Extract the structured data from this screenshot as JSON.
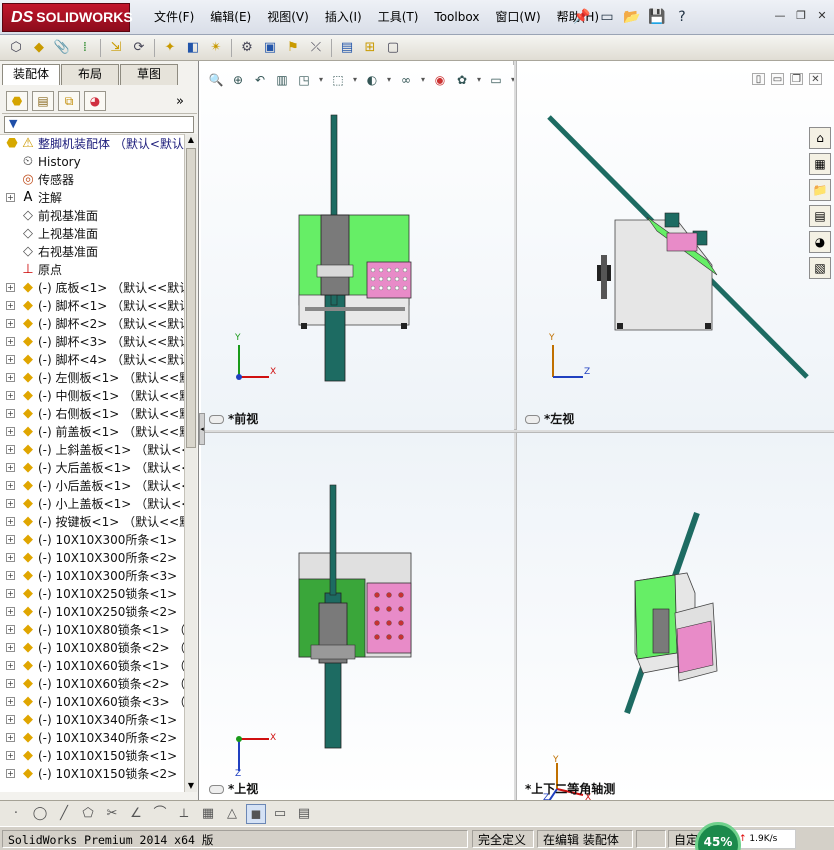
{
  "app": {
    "brand": "SOLIDWORKS",
    "brand_prefix": "DS",
    "menu": [
      "文件(F)",
      "编辑(E)",
      "视图(V)",
      "插入(I)",
      "工具(T)",
      "Toolbox",
      "窗口(W)",
      "帮助(H)"
    ]
  },
  "left_panel": {
    "tabs": [
      "装配体",
      "布局",
      "草图"
    ],
    "active_tab": "装配体",
    "tree": {
      "root": "整脚机装配体 （默认<默认",
      "features": [
        {
          "label": "History",
          "icon": "history-icon"
        },
        {
          "label": "传感器",
          "icon": "sensor-icon"
        },
        {
          "label": "注解",
          "icon": "annotation-icon"
        },
        {
          "label": "前视基准面",
          "icon": "plane-icon"
        },
        {
          "label": "上视基准面",
          "icon": "plane-icon"
        },
        {
          "label": "右视基准面",
          "icon": "plane-icon"
        },
        {
          "label": "原点",
          "icon": "origin-icon"
        }
      ],
      "components": [
        "(-) 底板<1> （默认<<默认",
        "(-) 脚杯<1> （默认<<默认",
        "(-) 脚杯<2> （默认<<默认",
        "(-) 脚杯<3> （默认<<默认",
        "(-) 脚杯<4> （默认<<默认",
        "(-) 左侧板<1> （默认<<默",
        "(-) 中侧板<1> （默认<<默",
        "(-) 右侧板<1> （默认<<默",
        "(-) 前盖板<1> （默认<<默",
        "(-) 上斜盖板<1> （默认<<",
        "(-) 大后盖板<1> （默认<<",
        "(-) 小后盖板<1> （默认<<",
        "(-) 小上盖板<1> （默认<<",
        "(-) 按键板<1> （默认<<默",
        "(-) 10X10X300所条<1> （",
        "(-) 10X10X300所条<2> （",
        "(-) 10X10X300所条<3> （",
        "(-) 10X10X250锁条<1> （",
        "(-) 10X10X250锁条<2> （",
        "(-) 10X10X80锁条<1> （默",
        "(-) 10X10X80锁条<2> （默",
        "(-) 10X10X60锁条<1> （默",
        "(-) 10X10X60锁条<2> （默",
        "(-) 10X10X60锁条<3> （默",
        "(-) 10X10X340所条<1> （",
        "(-) 10X10X340所条<2> （",
        "(-) 10X10X150锁条<1> （",
        "(-) 10X10X150锁条<2> （"
      ]
    }
  },
  "viewports": [
    {
      "label": "*前视",
      "axes": [
        "Y",
        "X"
      ]
    },
    {
      "label": "*左视",
      "axes": [
        "Y",
        "Z"
      ]
    },
    {
      "label": "*上视",
      "axes": [
        "X",
        "Z"
      ]
    },
    {
      "label": "*上下二等角轴测",
      "axes": [
        "Y",
        "X",
        "Z"
      ]
    }
  ],
  "status": {
    "app_version": "SolidWorks Premium 2014 x64 版",
    "definition": "完全定义",
    "mode": "在编辑 装配体",
    "custom": "自定义",
    "network_speed": "1.9K/s",
    "cpu_percent": "45%"
  },
  "colors": {
    "brand_red": "#c2162c",
    "part_green": "#66ee66",
    "keypad_pink": "#e88bc8",
    "rail_teal": "#1d6b62"
  }
}
